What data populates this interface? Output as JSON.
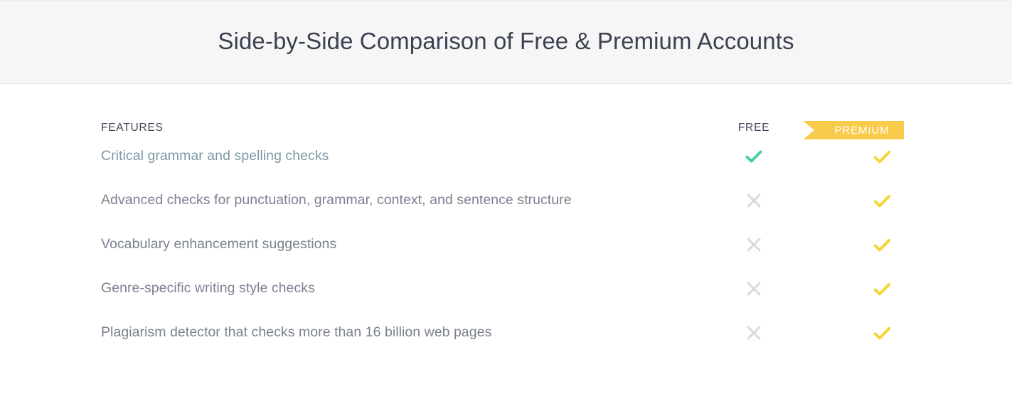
{
  "banner": {
    "title": "Side-by-Side Comparison of Free & Premium Accounts"
  },
  "table": {
    "headers": {
      "features": "FEATURES",
      "free": "FREE",
      "premium": "PREMIUM"
    },
    "rows": [
      {
        "label": "Critical grammar and spelling checks",
        "free": "check",
        "premium": "check"
      },
      {
        "label": "Advanced checks for punctuation, grammar, context, and sentence structure",
        "free": "cross",
        "premium": "check"
      },
      {
        "label": "Vocabulary enhancement suggestions",
        "free": "cross",
        "premium": "check"
      },
      {
        "label": "Genre-specific writing style checks",
        "free": "cross",
        "premium": "check"
      },
      {
        "label": "Plagiarism detector that checks more than 16 billion web pages",
        "free": "cross",
        "premium": "check"
      }
    ]
  },
  "icons": {
    "check_free_name": "green-check-icon",
    "check_premium_name": "yellow-check-icon",
    "cross_name": "gray-cross-icon"
  },
  "colors": {
    "banner_background": "#f6f6f6",
    "title_text": "#3b4151",
    "header_text": "#3f4557",
    "feature_text": "#7b8190",
    "feature_text_highlight": "#7f98a5",
    "premium_gold": "#f9cb4b",
    "check_free_green": "#48d0a0",
    "check_premium_yellow": "#f5d63d",
    "cross_gray": "#d9d9d9"
  }
}
